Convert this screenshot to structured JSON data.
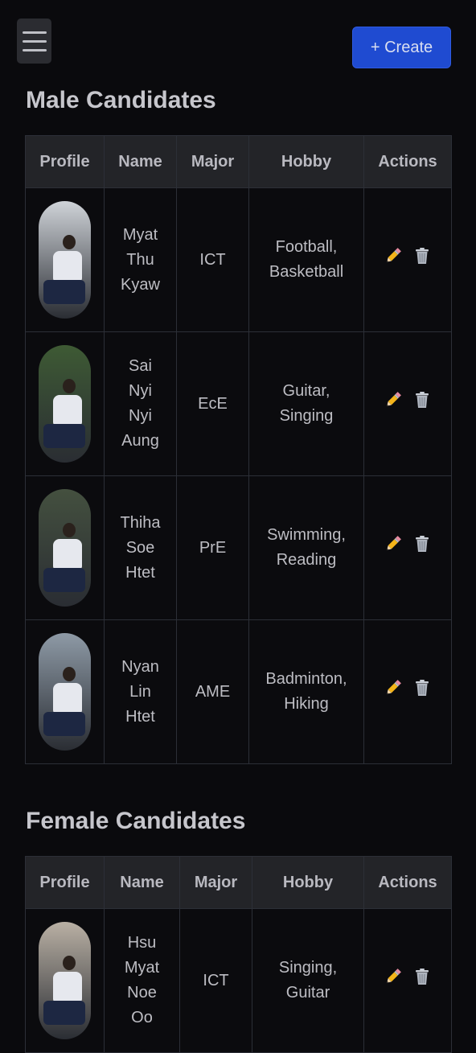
{
  "header": {
    "menu_icon": "hamburger-menu-icon",
    "create_label": "+ Create",
    "accent": "#1f4bd1"
  },
  "male": {
    "title": "Male Candidates",
    "columns": [
      "Profile",
      "Name",
      "Major",
      "Hobby",
      "Actions"
    ],
    "rows": [
      {
        "name": "Myat\nThu\nKyaw",
        "major": "ICT",
        "hobby": "Football,\nBasketball",
        "photo_bg": "#cfd3d8"
      },
      {
        "name": "Sai\nNyi\nNyi\nAung",
        "major": "EcE",
        "hobby": "Guitar,\nSinging",
        "photo_bg": "#3e5a34"
      },
      {
        "name": "Thiha\nSoe\nHtet",
        "major": "PrE",
        "hobby": "Swimming,\nReading",
        "photo_bg": "#44503f"
      },
      {
        "name": "Nyan\nLin\nHtet",
        "major": "AME",
        "hobby": "Badminton,\nHiking",
        "photo_bg": "#8e9aa6"
      }
    ]
  },
  "female": {
    "title": "Female Candidates",
    "columns": [
      "Profile",
      "Name",
      "Major",
      "Hobby",
      "Actions"
    ],
    "rows": [
      {
        "name": "Hsu\nMyat\nNoe\nOo",
        "major": "ICT",
        "hobby": "Singing,\nGuitar",
        "photo_bg": "#b9b0a4"
      }
    ]
  },
  "icons": {
    "edit": "pencil-icon",
    "delete": "trash-icon"
  }
}
